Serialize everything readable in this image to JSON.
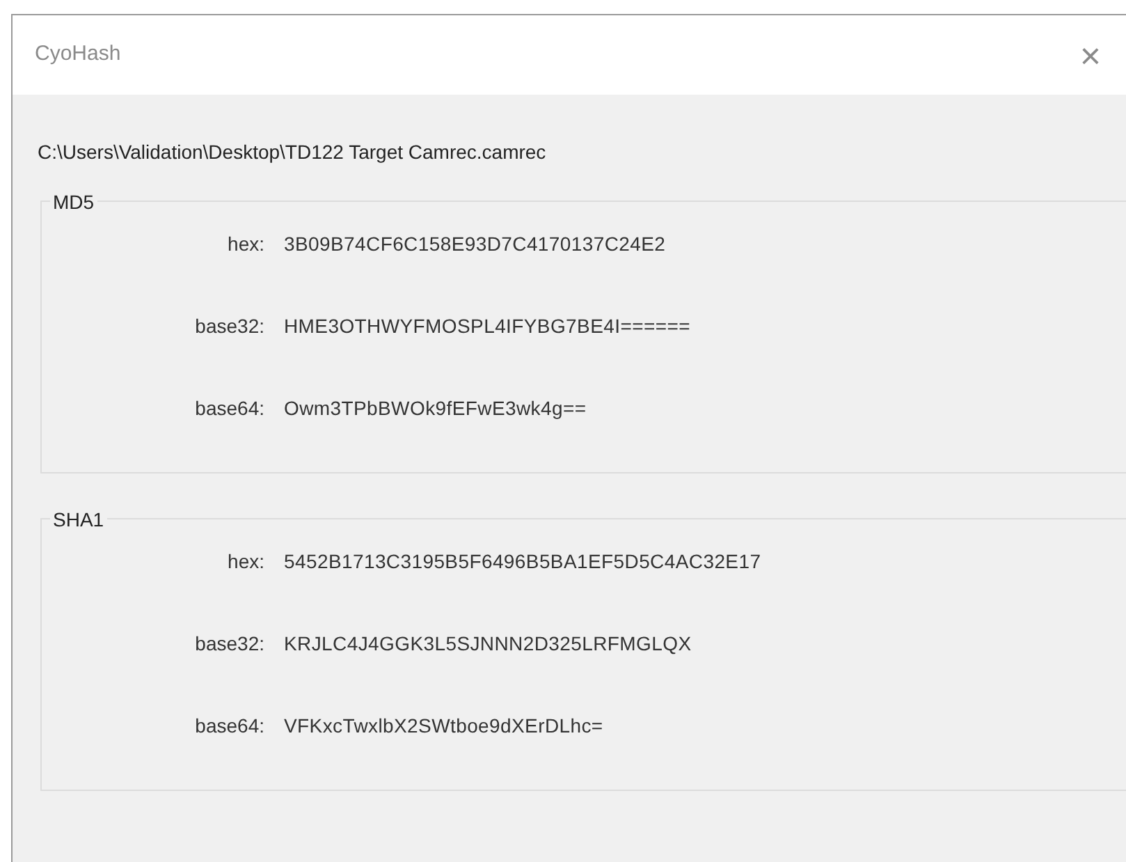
{
  "window": {
    "title": "CyoHash",
    "close": "×"
  },
  "path": "C:\\Users\\Validation\\Desktop\\TD122 Target Camrec.camrec",
  "groups": [
    {
      "title": "MD5",
      "rows": [
        {
          "label": "hex:",
          "value": "3B09B74CF6C158E93D7C4170137C24E2"
        },
        {
          "label": "base32:",
          "value": "HME3OTHWYFMOSPL4IFYBG7BE4I======"
        },
        {
          "label": "base64:",
          "value": "Owm3TPbBWOk9fEFwE3wk4g=="
        }
      ]
    },
    {
      "title": "SHA1",
      "rows": [
        {
          "label": "hex:",
          "value": "5452B1713C3195B5F6496B5BA1EF5D5C4AC32E17"
        },
        {
          "label": "base32:",
          "value": "KRJLC4J4GGK3L5SJNNN2D325LRFMGLQX"
        },
        {
          "label": "base64:",
          "value": "VFKxcTwxlbX2SWtboe9dXErDLhc="
        }
      ]
    }
  ]
}
